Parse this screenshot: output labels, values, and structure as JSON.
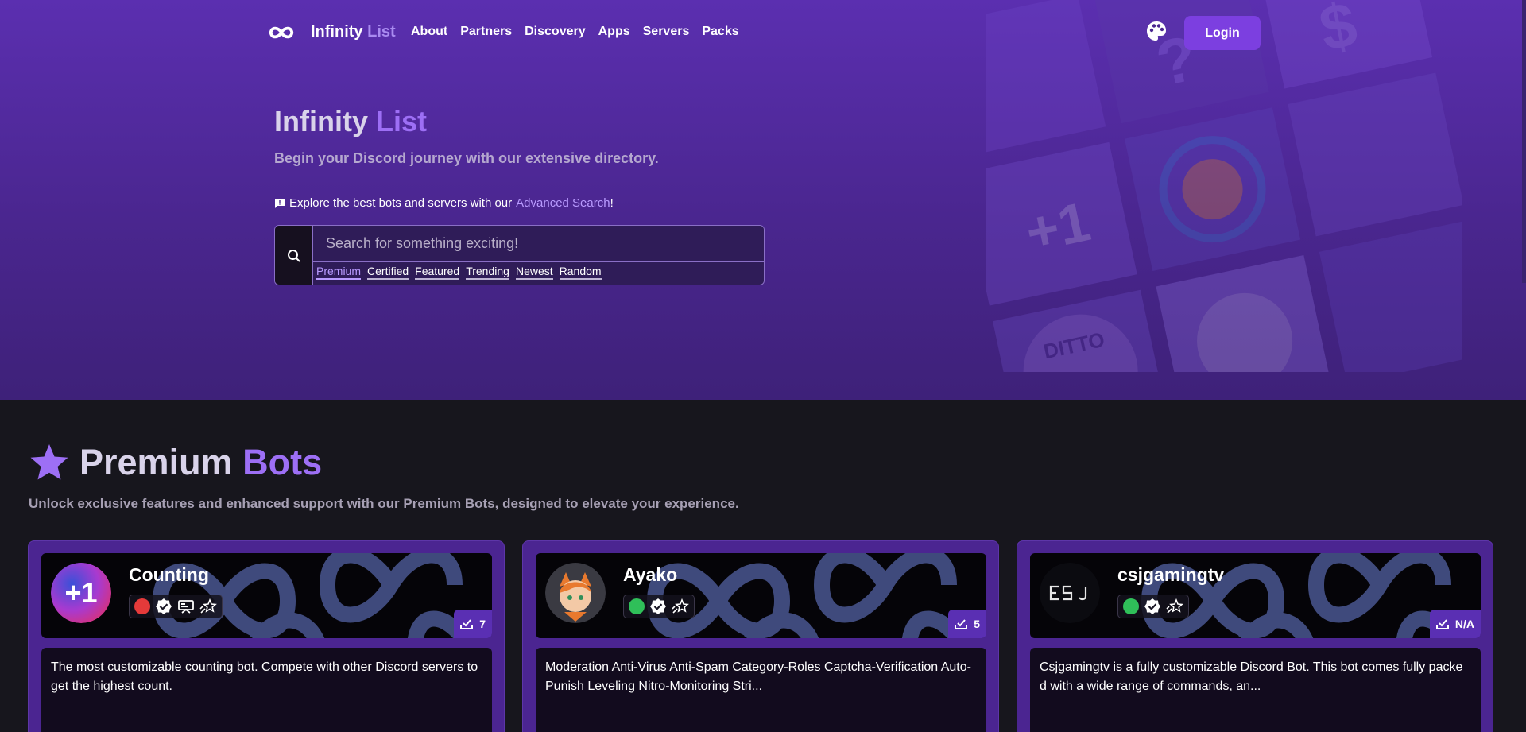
{
  "colors": {
    "accent": "#9d6ff5",
    "login_bg": "#7c3fe0",
    "hero_bg": "#5b2fb0",
    "page_bg": "#17161d",
    "card_bg": "#4b2591"
  },
  "nav": {
    "brand_main": "Infinity",
    "brand_accent": "List",
    "links": [
      "About",
      "Partners",
      "Discovery",
      "Apps",
      "Servers",
      "Packs"
    ],
    "theme_icon": "palette-icon",
    "login_label": "Login"
  },
  "hero": {
    "title_main": "Infinity",
    "title_accent": "List",
    "subtitle": "Begin your Discord journey with our extensive directory.",
    "explore_text": "Explore the best bots and servers with our",
    "explore_link": "Advanced Search",
    "explore_suffix": "!",
    "search_placeholder": "Search for something exciting!",
    "filters": [
      "Premium",
      "Certified",
      "Featured",
      "Trending",
      "Newest",
      "Random"
    ],
    "active_filter": "Premium"
  },
  "section": {
    "icon": "star-icon",
    "title_main": "Premium",
    "title_accent": "Bots",
    "subtitle": "Unlock exclusive features and enhanced support with our Premium Bots, designed to elevate your experience."
  },
  "bots": [
    {
      "name": "Counting",
      "status": "dnd",
      "status_color": "#e53a3a",
      "votes": "7",
      "badges": [
        "status-dot-icon",
        "verified-icon",
        "premium-icon",
        "certified-icon"
      ],
      "description": "The most customizable counting bot. Compete with other Discord servers to get the highest count."
    },
    {
      "name": "Ayako",
      "status": "online",
      "status_color": "#2fbf59",
      "votes": "5",
      "badges": [
        "status-dot-icon",
        "verified-icon",
        "certified-icon"
      ],
      "description": "Moderation Anti-Virus Anti-Spam Category-Roles Captcha-Verification Auto-Punish Leveling Nitro-Monitoring Stri..."
    },
    {
      "name": "csjgamingtv",
      "status": "online",
      "status_color": "#2fbf59",
      "votes": "N/A",
      "badges": [
        "status-dot-icon",
        "verified-icon",
        "certified-icon"
      ],
      "description": "Csjgamingtv is a fully customizable Discord Bot. This bot comes fully packe d with a wide range of commands, an..."
    }
  ]
}
